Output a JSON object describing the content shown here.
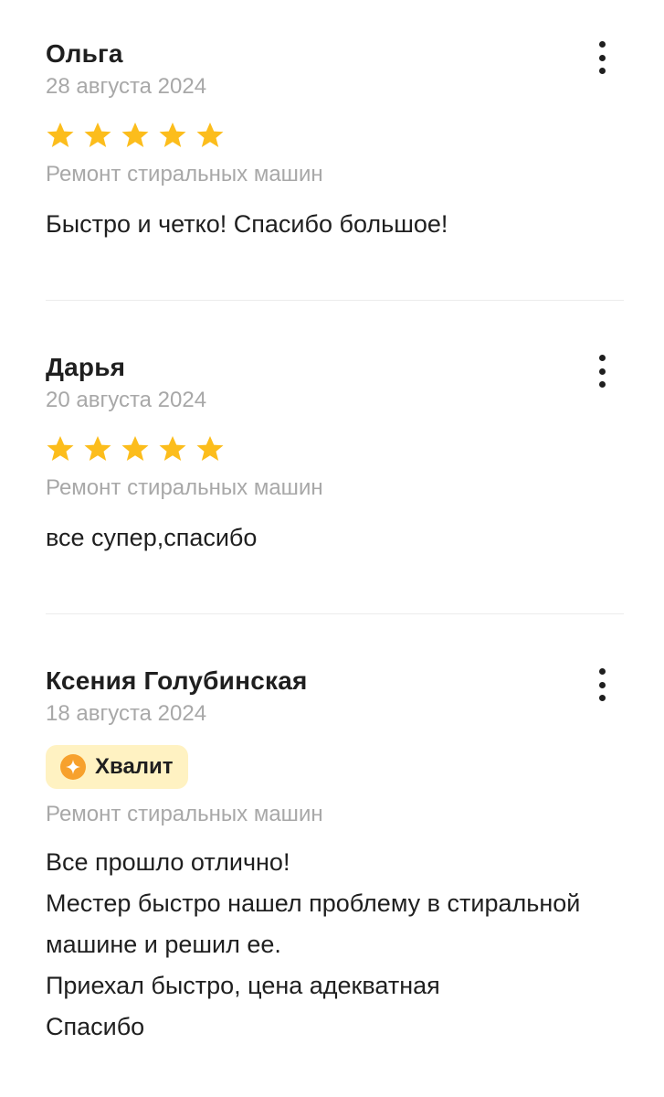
{
  "colors": {
    "star": "#fcbd1c",
    "badge_bg": "#fff2c2",
    "badge_icon": "#f7a12d",
    "muted_text": "#a8a8a8",
    "divider": "#ececec"
  },
  "reviews": [
    {
      "author": "Ольга",
      "date": "28 августа 2024",
      "rating": 5,
      "service": "Ремонт стиральных машин",
      "text": "Быстро и четко! Спасибо большое!"
    },
    {
      "author": "Дарья",
      "date": "20 августа 2024",
      "rating": 5,
      "service": "Ремонт стиральных машин",
      "text": "все супер,спасибо"
    },
    {
      "author": "Ксения Голубинская",
      "date": "18 августа 2024",
      "badge": {
        "label": "Хвалит",
        "icon": "sparkle-icon"
      },
      "service": "Ремонт стиральных машин",
      "text": "Все прошло отлично!\nМестер быстро нашел проблему в стиральной машине и решил ее.\nПриехал быстро, цена адекватная\nСпасибо"
    }
  ]
}
